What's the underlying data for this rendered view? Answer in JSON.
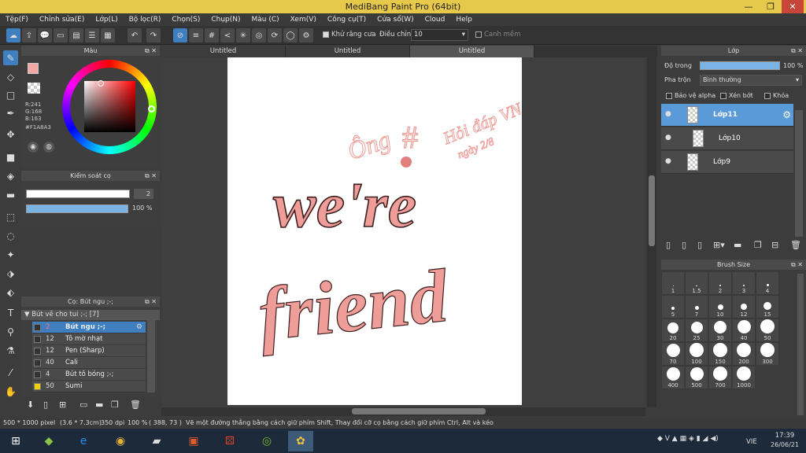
{
  "window": {
    "title": "MediBang Paint Pro (64bit)",
    "minimize": "—",
    "restore": "❐",
    "close": "✕"
  },
  "menu": [
    "Tệp(F)",
    "Chỉnh sửa(E)",
    "Lớp(L)",
    "Bộ lọc(R)",
    "Chọn(S)",
    "Chụp(N)",
    "Màu (C)",
    "Xem(V)",
    "Công cụ(T)",
    "Cửa sổ(W)",
    "Cloud",
    "Help"
  ],
  "toolbar": {
    "antialias_label": "Khử răng cưa",
    "adjust_label": "Điều chỉnh",
    "adjust_value": "10",
    "smooth_label": "Canh mềm"
  },
  "color_panel": {
    "title": "Màu",
    "r": "R:241",
    "g": "G:168",
    "b": "B:163",
    "hex": "#F1A8A3",
    "fg_color": "#F1A8A3"
  },
  "brush_control": {
    "title": "Kiểm soát cọ",
    "size_value": "2",
    "opacity_value": "100 %"
  },
  "brush_panel": {
    "title": "Cọ: Bút ngu ;-;",
    "group": "Bút vẽ cho tui ;-; [7]",
    "items": [
      {
        "size": "2",
        "name": "Bút ngu ;-;",
        "selected": true
      },
      {
        "size": "12",
        "name": "Tô mờ nhạt"
      },
      {
        "size": "12",
        "name": "Pen (Sharp)"
      },
      {
        "size": "40",
        "name": "Cali"
      },
      {
        "size": "4",
        "name": "Bút tô bóng ;-;"
      },
      {
        "size": "50",
        "name": "Sumi"
      }
    ]
  },
  "tabs": [
    "Untitled",
    "Untitled",
    "Untitled"
  ],
  "canvas_text": {
    "main1": "we're",
    "main2": "friend",
    "sig": "Ông",
    "hash": "#",
    "note1": "Hỏi đáp VN",
    "note2": "ngày 2/8"
  },
  "layer_panel": {
    "title": "Lớp",
    "opacity_label": "Độ trong",
    "opacity_value": "100 %",
    "blend_label": "Pha trộn",
    "blend_value": "Bình thường",
    "protect_alpha": "Bảo vệ alpha",
    "clipping": "Xén bớt",
    "lock": "Khóa",
    "layers": [
      {
        "name": "Lớp11",
        "active": true
      },
      {
        "name": "Lớp10",
        "active": false
      },
      {
        "name": "Lớp9",
        "active": false
      }
    ]
  },
  "brush_size": {
    "title": "Brush Size",
    "sizes": [
      "1",
      "1.5",
      "2",
      "3",
      "4",
      "5",
      "7",
      "10",
      "12",
      "15",
      "20",
      "25",
      "30",
      "40",
      "50",
      "70",
      "100",
      "150",
      "200",
      "300",
      "400",
      "500",
      "700",
      "1000"
    ]
  },
  "status": {
    "size": "500 * 1000 pixel",
    "cm": "(3.6 * 7.3cm)",
    "dpi": "350 dpi",
    "zoom": "100 %",
    "coords": "( 388, 73 )",
    "hint": "Vẽ một đường thẳng bằng cách giữ phím Shift, Thay đổi cỡ cọ bằng cách giữ phím Ctrl, Alt và kéo"
  },
  "taskbar": {
    "lang": "VIE",
    "time": "17:39",
    "date": "26/06/21"
  }
}
